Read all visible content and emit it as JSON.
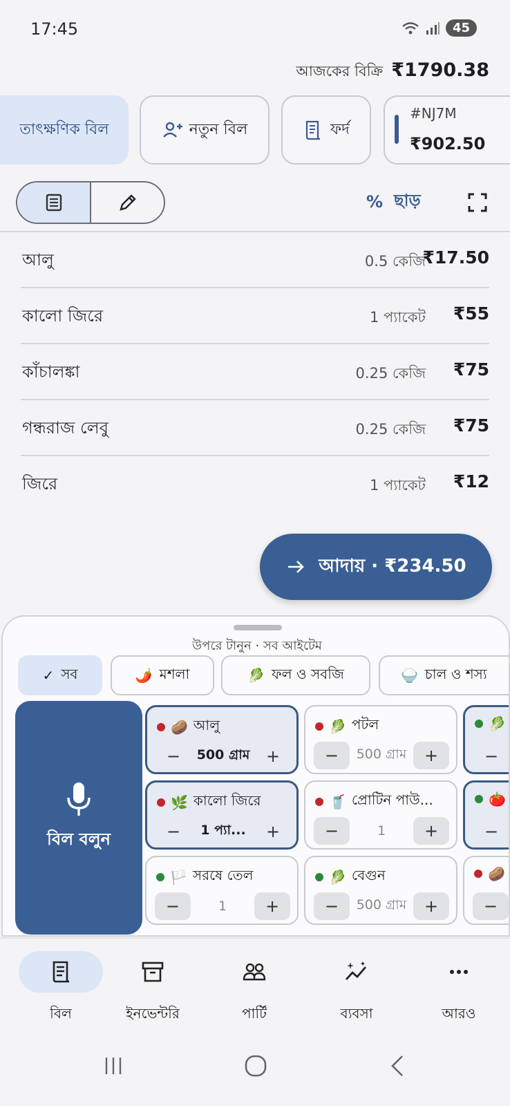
{
  "status": {
    "time": "17:45",
    "battery": "45"
  },
  "sales": {
    "label": "আজকের বিক্রি",
    "value": "₹1790.38"
  },
  "tabs": {
    "instant": "তাৎক্ষণিক বিল",
    "new_bill": "নতুন বিল",
    "list": "ফর্দ",
    "held_bill": {
      "code": "#NJ7M",
      "amount": "₹902.50"
    }
  },
  "toolbar": {
    "discount_label": "ছাড়"
  },
  "items": [
    {
      "name": "আলু",
      "qty": "0.5 কেজি",
      "price": "₹17.50"
    },
    {
      "name": "কালো জিরে",
      "qty": "1 প্যাকেট",
      "price": "₹55"
    },
    {
      "name": "কাঁচালঙ্কা",
      "qty": "0.25 কেজি",
      "price": "₹75"
    },
    {
      "name": "গন্ধরাজ লেবু",
      "qty": "0.25 কেজি",
      "price": "₹75"
    },
    {
      "name": "জিরে",
      "qty": "1 প্যাকেট",
      "price": "₹12"
    }
  ],
  "pay": {
    "label": "আদায় · ₹234.50"
  },
  "sheet": {
    "hint": "উপরে টানুন · সব আইটেম",
    "categories": [
      {
        "icon": "✓",
        "label": "সব"
      },
      {
        "icon": "🌶️",
        "label": "মশলা"
      },
      {
        "icon": "🥬",
        "label": "ফল ও সবজি"
      },
      {
        "icon": "🍚",
        "label": "চাল ও শস্য"
      }
    ],
    "mic_label": "বিল বলুন",
    "products": [
      {
        "emoji": "🥔",
        "name": "আলু",
        "value": "500 গ্রাম"
      },
      {
        "emoji": "🥬",
        "name": "পটল",
        "value": "500 গ্রাম"
      },
      {
        "emoji": "🥬",
        "name": "",
        "value": ""
      },
      {
        "emoji": "🌿",
        "name": "কালো জিরে",
        "value": "1 প্যা..."
      },
      {
        "emoji": "🥤",
        "name": "প্রোটিন পাউ...",
        "value": "1"
      },
      {
        "emoji": "🍅",
        "name": "",
        "value": ""
      },
      {
        "emoji": "🏳️",
        "name": "সরষে তেল",
        "value": "1"
      },
      {
        "emoji": "🥬",
        "name": "বেগুন",
        "value": "500 গ্রাম"
      },
      {
        "emoji": "🥔",
        "name": "",
        "value": ""
      }
    ],
    "step_minus": "−",
    "step_plus": "+"
  },
  "nav": {
    "bill": "বিল",
    "inventory": "ইনভেন্টরি",
    "party": "পার্টি",
    "business": "ব্যবসা",
    "more": "আরও"
  },
  "colors": {
    "accent": "#3a5f94",
    "chip_selected": "#dce6f7",
    "red_dot": "#c0262c",
    "green_dot": "#2a8a3a"
  }
}
